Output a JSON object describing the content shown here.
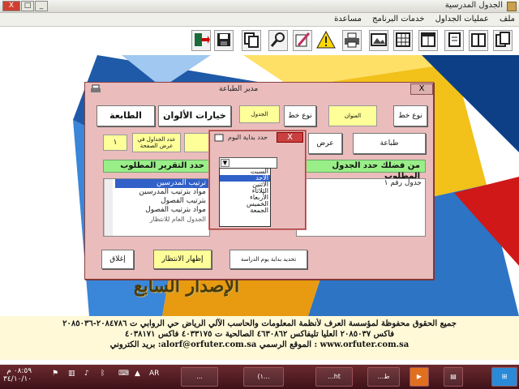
{
  "app": {
    "title": "الجدول المدرسية",
    "min": "_",
    "max": "□",
    "close": "X"
  },
  "menu": [
    "ملف",
    "عمليات الجداول",
    "خدمات البرنامج",
    "مساعدة"
  ],
  "toolbar_icons": [
    "exit-icon",
    "save-icon",
    "copy-icon",
    "search-icon",
    "edit-icon",
    "warning-icon",
    "printer-icon",
    "photo-icon",
    "grid-icon",
    "table-icon",
    "notes-icon",
    "folders-icon",
    "pages-icon"
  ],
  "banner": "الإصدار السابع",
  "footer": {
    "line1": "جميع الحقوق محفوظة لمؤسسة العرف لأنظمة المعلومات والحاسب الآلي الرياض حي الروابي ت ٢٠٨٤٧٨٦-٢٠٨٥٠٣٦",
    "line2": "فاكس ٢٠٨٥٠٣٧ العليا تليفاكس ٤٦٣٠٨٦٢ الصالحية ت ٤٠٣٣١٧٥ فاكس ٤٠٣٨١٧١",
    "line3": "بريد الكتروني :alorf@orfuter.com.sa الموقع الرسمي : www.orfuter.com.sa"
  },
  "dialog": {
    "title": "مدير الطباعة",
    "close": "X",
    "font_type_label": "نوع خط",
    "title_label": "العنوان",
    "font_type_label2": "نوع خط",
    "table_label": "الجدول",
    "color_options": "خيارات الألوان",
    "printer": "الطابعة",
    "print": "طباعة",
    "show": "عرض",
    "tables_in_width": "عدد الجداول في عرض الصفحة",
    "tables_value": "١",
    "green1": "من فضلك حدد الجدول المطلوب",
    "green2": "حدد التقرير المطلوب",
    "left_list": [
      "جدول رقم ١"
    ],
    "right_list": [
      "ترتيب المدرسين",
      "مواد بترتيب المدرسين",
      "بترتيب الفصول",
      "مواد بترتيب الفصول"
    ],
    "general_schedule": "الجدول العام للانتظار",
    "set_start_day": "تحديد بداية يوم الدراسة",
    "show_waiting": "إظهار الانتظار",
    "close_btn": "إغلاق"
  },
  "popup": {
    "title": "حدد بداية اليوم",
    "close": "X",
    "days": [
      "السبت",
      "الأحد",
      "الاثنين",
      "الثلاثاء",
      "الأربعاء",
      "الخميس",
      "الجمعة"
    ],
    "selected": "الأحد"
  },
  "taskbar": {
    "lang": "AR",
    "time": "٠٨:٥٩ م",
    "date": "٣٤/١٠/١٠",
    "task1": "...",
    "task2": "(١...",
    "task3": "...ht",
    "task4": "...ط"
  }
}
